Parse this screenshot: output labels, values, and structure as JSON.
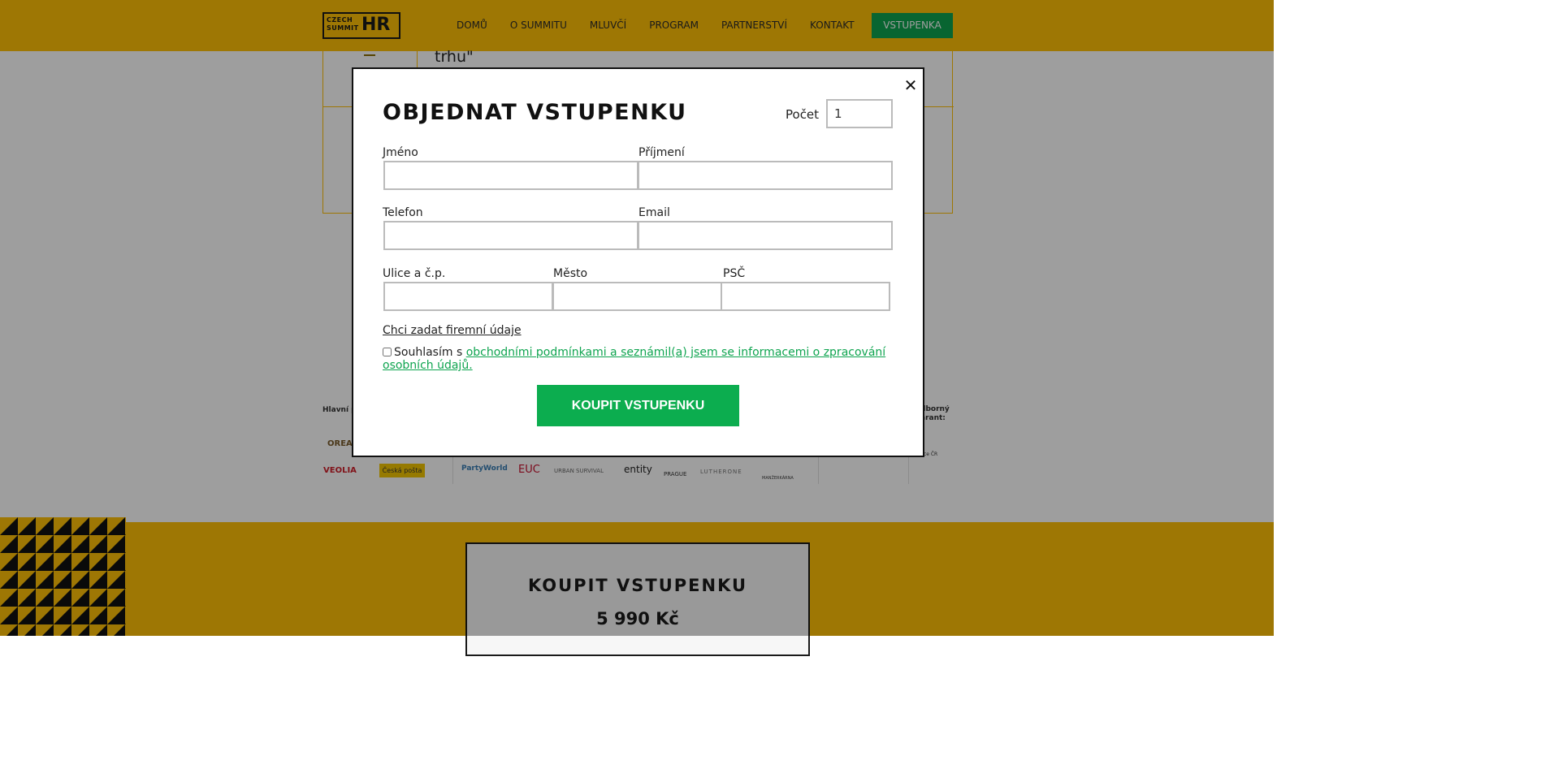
{
  "header": {
    "logo_line1": "CZECH",
    "logo_line2": "SUMMIT",
    "logo_hr": "HR",
    "nav": [
      "DOMŮ",
      "O SUMMITU",
      "MLUVČÍ",
      "PROGRAM",
      "PARTNERSTVÍ",
      "KONTAKT"
    ],
    "cta": "VSTUPENKA"
  },
  "background": {
    "quote_fragment": "trhu\"",
    "partners_main_label": "Hlavní p",
    "partners_expert_label": "dborný\narant:",
    "partner_logos": [
      "OREA",
      "VEOLIA",
      "Česká pošta",
      "PartyWorld",
      "EUC",
      "URBAN SURVIVAL",
      "entity",
      "PRAGUE",
      "LUTHERONE",
      "MANŽERKÁRNA",
      "práce ČR"
    ],
    "ticket_card_title": "KOUPIT VSTUPENKU",
    "ticket_card_price": "5 990 Kč"
  },
  "modal": {
    "title": "OBJEDNAT VSTUPENKU",
    "count_label": "Počet",
    "count_value": "1",
    "fields": {
      "first_name": "Jméno",
      "last_name": "Příjmení",
      "phone": "Telefon",
      "email": "Email",
      "street": "Ulice a č.p.",
      "city": "Město",
      "zip": "PSČ"
    },
    "company_link": "Chci zadat firemní údaje",
    "consent_prefix": "Souhlasím s ",
    "consent_link": "obchodními podmínkami a seznámil(a) jsem se informacemi o zpracování osobních údajů.",
    "consent_checked": false,
    "submit": "KOUPIT VSTUPENKU",
    "close_symbol": "✕"
  },
  "colors": {
    "brand_yellow": "#ffc107",
    "accent_green": "#0cad4f",
    "link_green": "#0ea44f"
  }
}
